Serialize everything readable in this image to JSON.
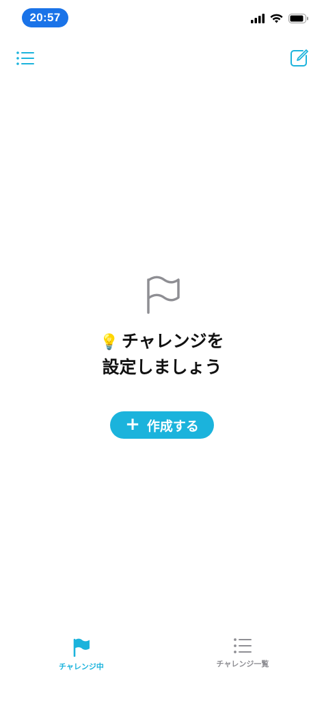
{
  "status_bar": {
    "time": "20:57"
  },
  "nav_bar": {
    "left_icon": "list-icon",
    "right_icon": "compose-icon"
  },
  "empty_state": {
    "icon": "flag-outline-icon",
    "bulb": "💡",
    "message_line1": "チャレンジを",
    "message_line2": "設定しましょう",
    "create_button_label": "作成する"
  },
  "tab_bar": {
    "tabs": [
      {
        "label": "チャレンジ中",
        "icon": "flag-filled-icon",
        "active": true
      },
      {
        "label": "チャレンジ一覧",
        "icon": "list-icon",
        "active": false
      }
    ]
  },
  "colors": {
    "accent": "#1bb3dc",
    "inactive": "#8e8e93",
    "time_pill": "#1a73e8",
    "text": "#111111"
  }
}
